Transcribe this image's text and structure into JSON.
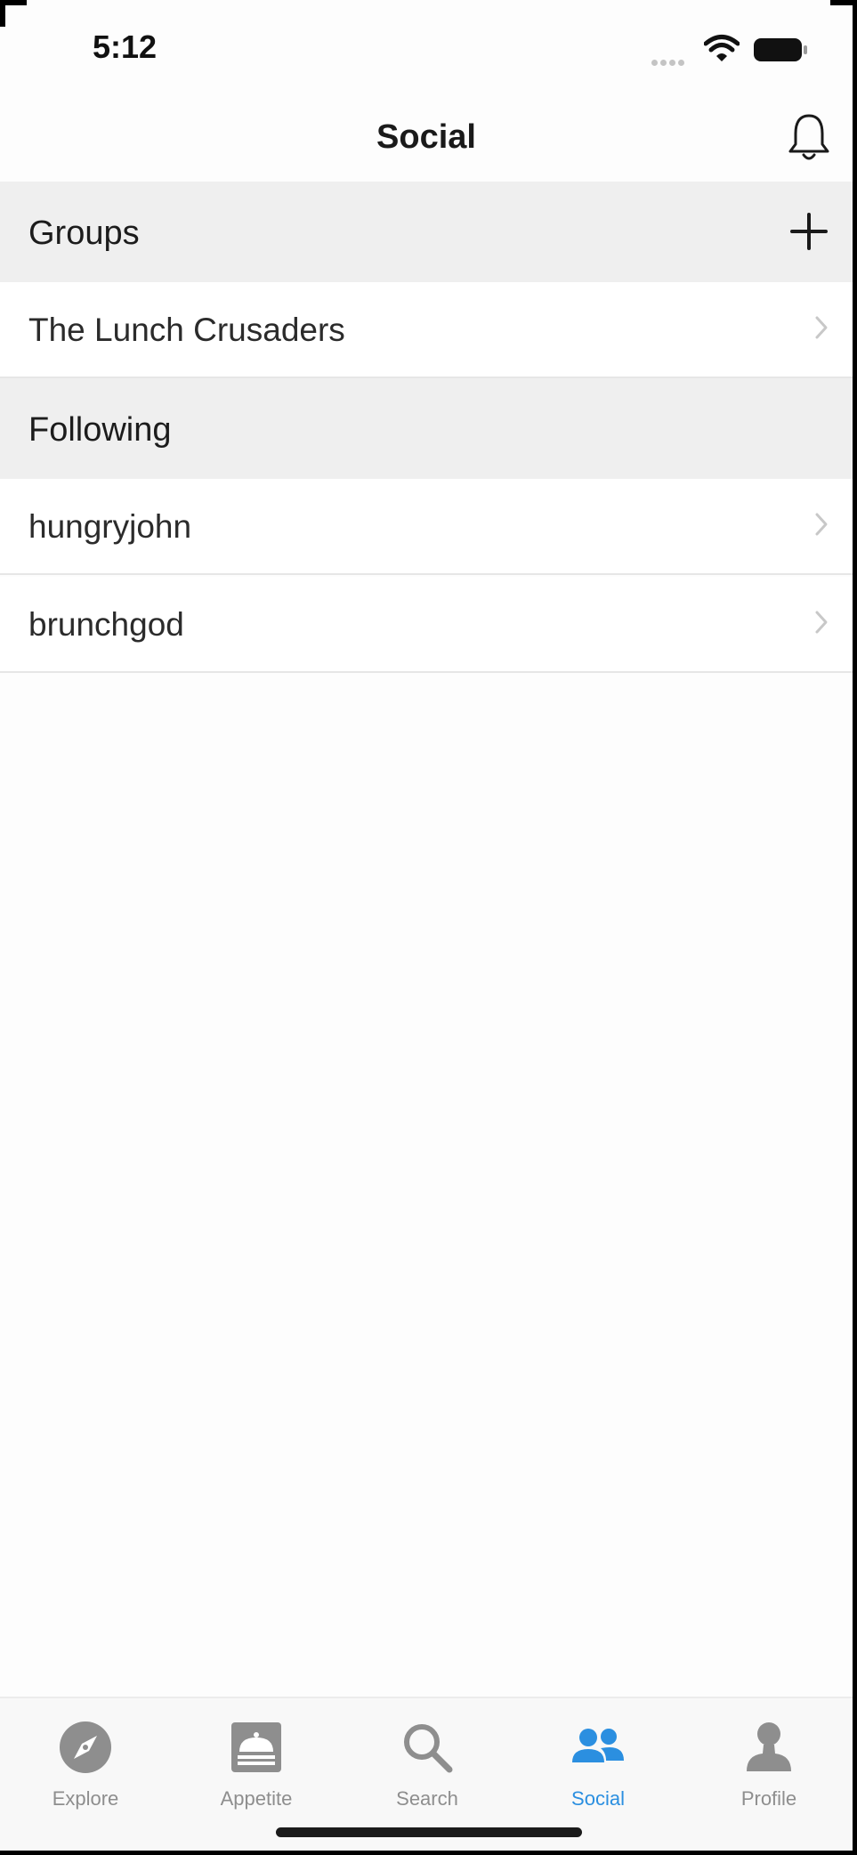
{
  "status_bar": {
    "time": "5:12"
  },
  "nav": {
    "title": "Social",
    "notifications_icon": "bell-icon"
  },
  "groups_section": {
    "title": "Groups",
    "add_icon": "plus-icon",
    "items": [
      {
        "label": "The Lunch Crusaders"
      }
    ]
  },
  "following_section": {
    "title": "Following",
    "items": [
      {
        "label": "hungryjohn"
      },
      {
        "label": "brunchgod"
      }
    ]
  },
  "tab_bar": {
    "active_color": "#2b8fe0",
    "inactive_color": "#8e8e8e",
    "tabs": [
      {
        "label": "Explore",
        "icon": "compass-icon"
      },
      {
        "label": "Appetite",
        "icon": "cloche-icon"
      },
      {
        "label": "Search",
        "icon": "search-icon"
      },
      {
        "label": "Social",
        "icon": "people-icon",
        "active": true
      },
      {
        "label": "Profile",
        "icon": "person-icon"
      }
    ]
  }
}
